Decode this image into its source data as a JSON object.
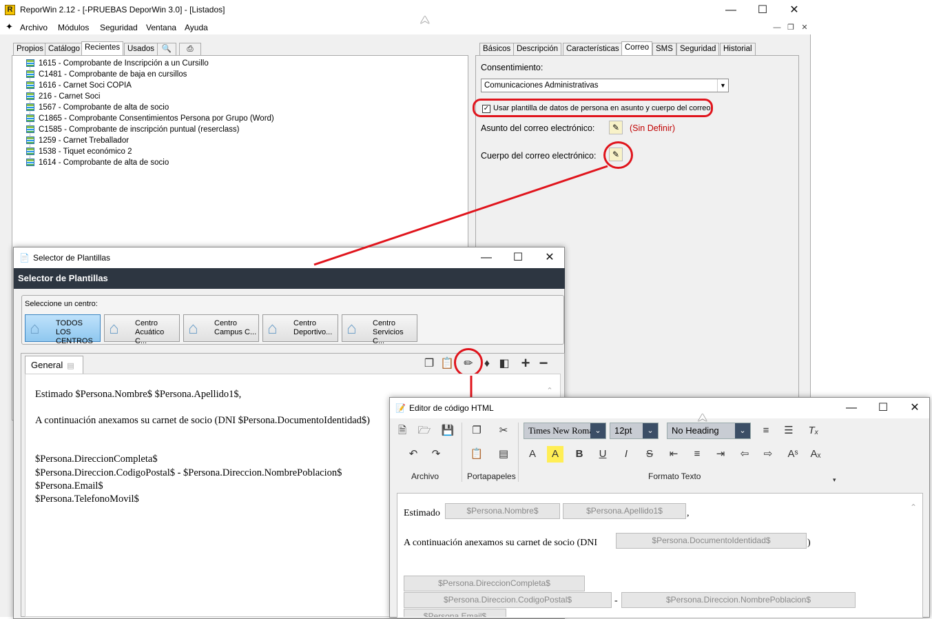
{
  "app": {
    "title": "ReporWin 2.12 - [-PRUEBAS DeporWin 3.0] - [Listados]",
    "icon_letter": "R",
    "menu": [
      "Archivo",
      "Módulos",
      "Seguridad",
      "Ventana",
      "Ayuda"
    ]
  },
  "left_tabs": [
    "Propios",
    "Catálogo",
    "Recientes",
    "Usados"
  ],
  "left_tab_selected": "Recientes",
  "tree_items": [
    "1615 - Comprobante de Inscripción a un Cursillo",
    "C1481 - Comprobante de baja en cursillos",
    "1616 - Carnet Soci COPIA",
    "216 - Carnet Soci",
    "1567 - Comprobante de alta de socio",
    "C1865 - Comprobante Consentimientos Persona por Grupo (Word)",
    "C1585 - Comprobante de inscripción puntual (reserclass)",
    "1259 - Carnet Treballador",
    "1538 - Tiquet económico 2",
    "1614 - Comprobante de alta de socio"
  ],
  "right_tabs": [
    "Básicos",
    "Descripción",
    "Características",
    "Correo",
    "SMS",
    "Seguridad",
    "Historial"
  ],
  "right_tab_selected": "Correo",
  "correo": {
    "consent_label": "Consentimiento:",
    "consent_value": "Comunicaciones Administrativas",
    "use_template_label": "Usar plantilla de datos de persona en asunto y cuerpo del correo",
    "use_template_checked": true,
    "subject_label": "Asunto del correo electrónico:",
    "subject_value": "(Sin Definir)",
    "body_label": "Cuerpo del correo electrónico:"
  },
  "selector": {
    "window_title": "Selector de Plantillas",
    "header": "Selector de Plantillas",
    "center_prompt": "Seleccione un centro:",
    "centers": [
      {
        "line1": "TODOS LOS",
        "line2": "CENTROS",
        "selected": true
      },
      {
        "line1": "Centro",
        "line2": "Acuático C...",
        "selected": false
      },
      {
        "line1": "Centro",
        "line2": "Campus C...",
        "selected": false
      },
      {
        "line1": "Centro",
        "line2": "Deportivo...",
        "selected": false
      },
      {
        "line1": "Centro",
        "line2": "Servicios C...",
        "selected": false
      }
    ],
    "tab_label": "General",
    "text_lines": [
      "Estimado $Persona.Nombre$ $Persona.Apellido1$,",
      "A continuación anexamos su carnet de socio (DNI $Persona.DocumentoIdentidad$)",
      "$Persona.DireccionCompleta$",
      "$Persona.Direccion.CodigoPostal$ - $Persona.Direccion.NombrePoblacion$",
      "$Persona.Email$",
      "$Persona.TelefonoMovil$"
    ]
  },
  "editor": {
    "window_title": "Editor de código HTML",
    "font_name": "Times New Roman",
    "font_size": "12pt",
    "heading": "No Heading",
    "groups": [
      "Archivo",
      "Portapapeles",
      "Formato Texto"
    ],
    "greeting": "Estimado",
    "tag_nombre": "$Persona.Nombre$",
    "tag_apellido": "$Persona.Apellido1$",
    "comma": ",",
    "annex_text": "A continuación anexamos su carnet de socio (DNI",
    "tag_dni": "$Persona.DocumentoIdentidad$",
    "close_paren": ")",
    "tag_direccion": "$Persona.DireccionCompleta$",
    "tag_cp": "$Persona.Direccion.CodigoPostal$",
    "dash": "-",
    "tag_poblacion": "$Persona.Direccion.NombrePoblacion$",
    "tag_email": "$Persona.Email$"
  },
  "colors": {
    "highlight": "#e0141c",
    "dark_header": "#2d3641",
    "sin_definir": "#c00000"
  }
}
